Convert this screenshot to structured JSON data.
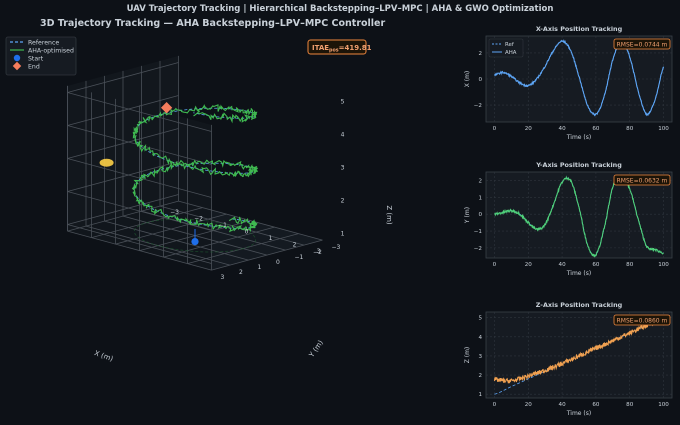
{
  "suptitle": "UAV Trajectory Tracking  |  Hierarchical Backstepping–LPV–MPC  |  AHA & GWO Optimization",
  "colors": {
    "bg": "#0d1117",
    "panel": "#161b22",
    "grid": "#2f353d",
    "text": "#c9d1d9",
    "ref": "#5da5f5",
    "x": "#5da5f5",
    "y": "#4fd07a",
    "z": "#f0a050",
    "traj3d": "#3fb950",
    "start": "#1f6feb",
    "end": "#f47c5c",
    "mid": "#f2c744",
    "badge_border": "#f0883e",
    "badge_text": "#f0a070"
  },
  "chart_data": [
    {
      "type": "line3d",
      "title": "3D Trajectory Tracking — AHA Backstepping–LPV–MPC Controller",
      "itae_badge": {
        "label": "ITAE",
        "sub": "pos",
        "value": "=419.81"
      },
      "legend": {
        "placement": "top-left",
        "items": [
          {
            "name": "Reference",
            "style": "dashed"
          },
          {
            "name": "AHA-optimised",
            "style": "solid"
          },
          {
            "name": "Start",
            "style": "circle"
          },
          {
            "name": "End",
            "style": "diamond"
          }
        ]
      },
      "xlabel": "X (m)",
      "ylabel": "Y (m)",
      "zlabel": "Z (m)",
      "xlim": [
        -3,
        3
      ],
      "ylim": [
        -3,
        3
      ],
      "zlim": [
        0.8,
        5.2
      ],
      "xticks": [
        "−3",
        "−2",
        "−1",
        "0",
        "1",
        "2",
        "3"
      ],
      "yticks": [
        "−3",
        "−2",
        "−1",
        "0",
        "1",
        "2",
        "3"
      ],
      "zticks": [
        "1",
        "2",
        "3",
        "4",
        "5"
      ],
      "start": [
        0,
        0,
        1
      ],
      "end": [
        -1.8,
        -0.8,
        4.2
      ],
      "helix": {
        "turns": 2.4,
        "radius": 2.0,
        "z_start": 1.0,
        "z_end": 5.0
      }
    },
    {
      "type": "line",
      "title": "X-Axis Position Tracking",
      "xlabel": "Time (s)",
      "ylabel": "X (m)",
      "xlim": [
        -5,
        105
      ],
      "ylim": [
        -3.3,
        3.3
      ],
      "xticks": [
        "0",
        "20",
        "40",
        "60",
        "80",
        "100"
      ],
      "yticks": [
        "−2",
        "0",
        "2"
      ],
      "ytick_values": [
        -2,
        0,
        2
      ],
      "xtick_values": [
        0,
        20,
        40,
        60,
        80,
        100
      ],
      "legend": {
        "placement": "top-left",
        "items": [
          "Ref",
          "AHA"
        ]
      },
      "rmse": "RMSE=0.0744 m",
      "x": [
        0,
        5,
        10,
        15,
        20,
        25,
        30,
        35,
        40,
        45,
        50,
        55,
        60,
        65,
        70,
        75,
        80,
        85,
        90,
        95,
        100
      ],
      "series": [
        {
          "name": "Ref",
          "values": [
            0.3,
            0.5,
            0.2,
            -0.3,
            -0.5,
            0.0,
            1.0,
            2.2,
            2.9,
            2.2,
            0.2,
            -2.0,
            -2.7,
            -1.3,
            1.5,
            2.9,
            1.7,
            -0.9,
            -2.7,
            -1.6,
            0.9
          ]
        },
        {
          "name": "AHA",
          "values": [
            0.3,
            0.5,
            0.2,
            -0.3,
            -0.5,
            0.0,
            1.0,
            2.2,
            2.9,
            2.2,
            0.2,
            -2.0,
            -2.7,
            -1.3,
            1.5,
            2.9,
            1.7,
            -0.9,
            -2.7,
            -1.6,
            0.9
          ]
        }
      ]
    },
    {
      "type": "line",
      "title": "Y-Axis Position Tracking",
      "xlabel": "Time (s)",
      "ylabel": "Y (m)",
      "xlim": [
        -5,
        105
      ],
      "ylim": [
        -2.6,
        2.5
      ],
      "xticks": [
        "0",
        "20",
        "40",
        "60",
        "80",
        "100"
      ],
      "yticks": [
        "−2",
        "−1",
        "0",
        "1",
        "2"
      ],
      "ytick_values": [
        -2,
        -1,
        0,
        1,
        2
      ],
      "xtick_values": [
        0,
        20,
        40,
        60,
        80,
        100
      ],
      "rmse": "RMSE=0.0632 m",
      "x": [
        0,
        5,
        10,
        15,
        20,
        25,
        30,
        35,
        40,
        45,
        50,
        55,
        60,
        65,
        70,
        75,
        80,
        85,
        90,
        95,
        100
      ],
      "series": [
        {
          "name": "Ref",
          "values": [
            0.0,
            0.1,
            0.2,
            0.0,
            -0.5,
            -0.9,
            -0.6,
            0.6,
            1.9,
            2.0,
            0.4,
            -1.8,
            -2.4,
            -0.8,
            1.6,
            2.2,
            1.5,
            -0.3,
            -1.9,
            -2.1,
            -2.3
          ]
        },
        {
          "name": "AHA",
          "values": [
            0.0,
            0.1,
            0.2,
            0.0,
            -0.5,
            -0.9,
            -0.6,
            0.6,
            1.9,
            2.0,
            0.4,
            -1.8,
            -2.4,
            -0.8,
            1.6,
            2.2,
            1.5,
            -0.3,
            -1.9,
            -2.1,
            -2.3
          ]
        }
      ]
    },
    {
      "type": "line",
      "title": "Z-Axis Position Tracking",
      "xlabel": "Time (s)",
      "ylabel": "Z (m)",
      "xlim": [
        -5,
        105
      ],
      "ylim": [
        0.8,
        5.3
      ],
      "xticks": [
        "0",
        "20",
        "40",
        "60",
        "80",
        "100"
      ],
      "yticks": [
        "1",
        "2",
        "3",
        "4",
        "5"
      ],
      "ytick_values": [
        1,
        2,
        3,
        4,
        5
      ],
      "xtick_values": [
        0,
        20,
        40,
        60,
        80,
        100
      ],
      "rmse": "RMSE=0.0860 m",
      "x": [
        0,
        10,
        20,
        30,
        40,
        50,
        60,
        70,
        80,
        90,
        100
      ],
      "series": [
        {
          "name": "Ref",
          "values": [
            1.0,
            1.4,
            1.8,
            2.2,
            2.6,
            3.0,
            3.4,
            3.8,
            4.2,
            4.6,
            5.0
          ]
        },
        {
          "name": "AHA",
          "values": [
            1.75,
            1.7,
            1.95,
            2.25,
            2.6,
            3.0,
            3.4,
            3.8,
            4.2,
            4.6,
            4.95
          ]
        }
      ]
    }
  ]
}
